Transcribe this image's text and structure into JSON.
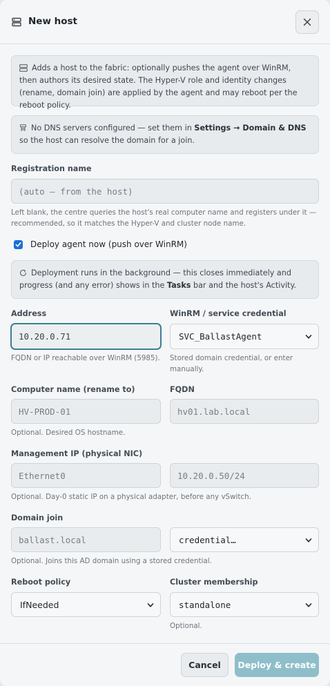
{
  "dialog": {
    "title": "New host",
    "close_icon": "close-icon",
    "header_icon": "server-icon"
  },
  "notes": {
    "intro": "Adds a host to the fabric: optionally pushes the agent over WinRM, then authors its desired state. The Hyper-V role and identity changes (rename, domain join) are applied by the agent and may reboot per the reboot policy.",
    "dns_before": "No DNS servers configured — set them in ",
    "dns_link": "Settings → Domain & DNS",
    "dns_after": " so the host can resolve the domain for a join.",
    "deploy_before": "Deployment runs in the background — this closes immediately and progress (and any error) shows in the ",
    "deploy_bold": "Tasks",
    "deploy_after": " bar and the host's Activity."
  },
  "registration": {
    "label": "Registration name",
    "placeholder": "(auto — from the host)",
    "hint": "Left blank, the centre queries the host's real computer name and registers under it — recommended, so it matches the Hyper-V and cluster node name."
  },
  "deploy_agent": {
    "label": "Deploy agent now (push over WinRM)",
    "checked": true
  },
  "address": {
    "label": "Address",
    "value": "10.20.0.71",
    "hint": "FQDN or IP reachable over WinRM (5985)."
  },
  "winrm": {
    "label": "WinRM / service credential",
    "selected": "SVC_BallastAgent",
    "hint": "Stored domain credential, or enter manually."
  },
  "computer_name": {
    "label": "Computer name (rename to)",
    "placeholder": "HV-PROD-01",
    "hint": "Optional. Desired OS hostname."
  },
  "fqdn": {
    "label": "FQDN",
    "placeholder": "hv01.lab.local"
  },
  "mgmt_ip": {
    "label": "Management IP (physical NIC)",
    "adapter_placeholder": "Ethernet0",
    "ip_placeholder": "10.20.0.50/24",
    "hint": "Optional. Day-0 static IP on a physical adapter, before any vSwitch."
  },
  "domain_join": {
    "label": "Domain join",
    "placeholder": "ballast.local",
    "credential_selected": "credential…",
    "hint": "Optional. Joins this AD domain using a stored credential."
  },
  "reboot": {
    "label": "Reboot policy",
    "selected": "IfNeeded"
  },
  "cluster": {
    "label": "Cluster membership",
    "selected": "standalone",
    "hint": "Optional."
  },
  "footer": {
    "cancel": "Cancel",
    "deploy": "Deploy & create"
  },
  "colors": {
    "accent": "#3d7f93",
    "primary_disabled": "#8fbecb",
    "checkbox": "#1a6fd6"
  }
}
